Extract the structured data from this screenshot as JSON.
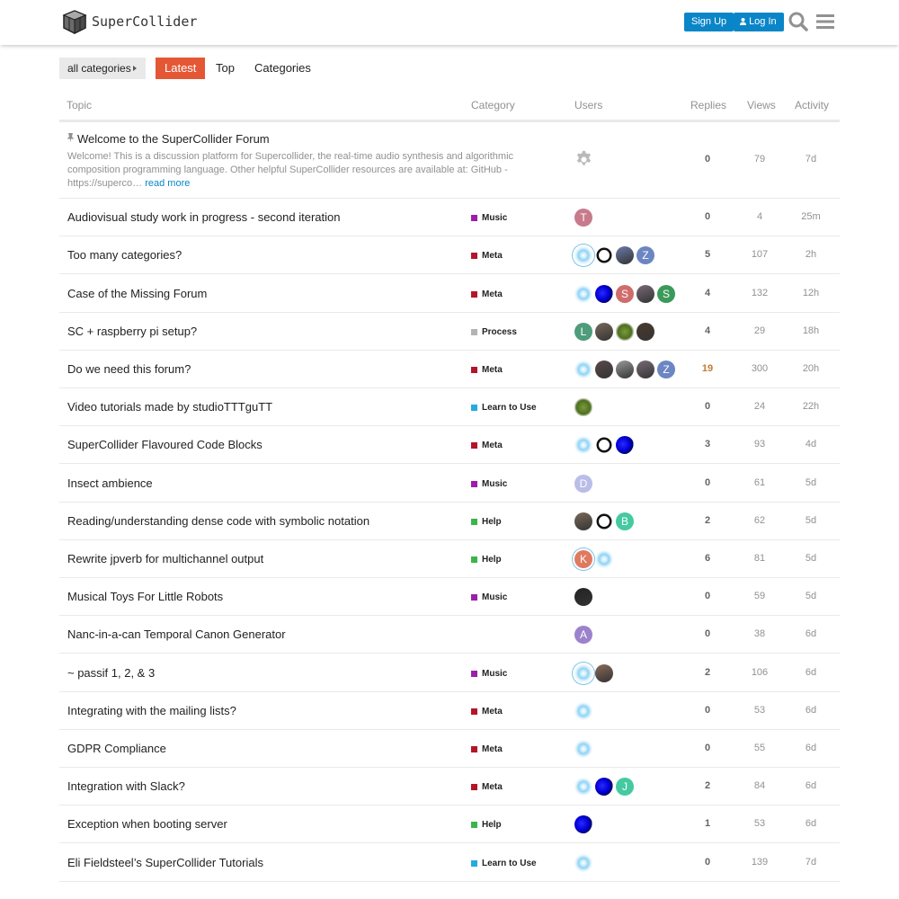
{
  "header": {
    "logo_text": "SuperCollider",
    "signup_label": "Sign Up",
    "login_label": "Log In",
    "icons": [
      "search-icon",
      "hamburger-menu-icon",
      "cube-logo-icon",
      "user-icon"
    ]
  },
  "nav": {
    "category_dropdown": "all categories",
    "tabs": [
      "Latest",
      "Top",
      "Categories"
    ],
    "active_tab": "Latest"
  },
  "columns": [
    "Topic",
    "Category",
    "Users",
    "Replies",
    "Views",
    "Activity"
  ],
  "colors": {
    "accent": "#e45735",
    "link": "#0a86c8",
    "Music": "#9b1fa8",
    "Meta": "#b3152b",
    "Process": "#b3b3b3",
    "Learn to Use": "#25aae1",
    "Help": "#3ab54a"
  },
  "pinned": {
    "title": "Welcome to the SuperCollider Forum",
    "excerpt": "Welcome! This is a discussion platform for Supercollider, the real-time audio synthesis and algorithmic composition programming language. Other helpful SuperCollider resources are available at: GitHub - https://superco…",
    "read_more": "read more",
    "replies": "0",
    "views": "79",
    "activity": "7d"
  },
  "topics": [
    {
      "title": "Audiovisual study work in progress - second iteration",
      "category": "Music",
      "replies": "0",
      "views": "4",
      "activity": "25m",
      "users": [
        {
          "letter": "T",
          "bg": "#c77b8b"
        }
      ]
    },
    {
      "title": "Too many categories?",
      "category": "Meta",
      "replies": "5",
      "views": "107",
      "activity": "2h",
      "users": [
        {
          "type": "glow",
          "ring": true
        },
        {
          "type": "loop"
        },
        {
          "type": "pic",
          "bg": "#6a7ba8"
        },
        {
          "letter": "Z",
          "bg": "#6b86c2"
        }
      ]
    },
    {
      "title": "Case of the Missing Forum",
      "category": "Meta",
      "replies": "4",
      "views": "132",
      "activity": "12h",
      "users": [
        {
          "type": "glow"
        },
        {
          "type": "blob"
        },
        {
          "letter": "S",
          "bg": "#d06c6c"
        },
        {
          "type": "pic",
          "bg": "#7a6a78"
        },
        {
          "letter": "S",
          "bg": "#3b9a5a"
        }
      ]
    },
    {
      "title": "SC + raspberry pi setup?",
      "category": "Process",
      "replies": "4",
      "views": "29",
      "activity": "18h",
      "users": [
        {
          "letter": "L",
          "bg": "#4f9c7a"
        },
        {
          "type": "pic",
          "bg": "#7a6a5a"
        },
        {
          "type": "moss"
        },
        {
          "type": "pic",
          "bg": "#4a3a2a"
        }
      ]
    },
    {
      "title": "Do we need this forum?",
      "category": "Meta",
      "replies": "19",
      "views": "300",
      "activity": "20h",
      "hot": true,
      "users": [
        {
          "type": "glow"
        },
        {
          "type": "pic",
          "bg": "#5a4a4a"
        },
        {
          "type": "pic",
          "bg": "#9a9a9a"
        },
        {
          "type": "pic",
          "bg": "#7a6a78"
        },
        {
          "letter": "Z",
          "bg": "#6b86c2"
        }
      ]
    },
    {
      "title": "Video tutorials made by studioTTTguTT",
      "category": "Learn to Use",
      "replies": "0",
      "views": "24",
      "activity": "22h",
      "users": [
        {
          "type": "moss"
        }
      ]
    },
    {
      "title": "SuperCollider Flavoured Code Blocks",
      "category": "Meta",
      "replies": "3",
      "views": "93",
      "activity": "4d",
      "users": [
        {
          "type": "glow"
        },
        {
          "type": "loop"
        },
        {
          "type": "blob"
        }
      ]
    },
    {
      "title": "Insect ambience",
      "category": "Music",
      "replies": "0",
      "views": "61",
      "activity": "5d",
      "users": [
        {
          "letter": "D",
          "bg": "#b9bde8"
        }
      ]
    },
    {
      "title": "Reading/understanding dense code with symbolic notation",
      "category": "Help",
      "replies": "2",
      "views": "62",
      "activity": "5d",
      "users": [
        {
          "type": "pic",
          "bg": "#7a6a5a"
        },
        {
          "type": "loop"
        },
        {
          "letter": "B",
          "bg": "#45c9a0"
        }
      ]
    },
    {
      "title": "Rewrite jpverb for multichannel output",
      "category": "Help",
      "replies": "6",
      "views": "81",
      "activity": "5d",
      "users": [
        {
          "letter": "K",
          "bg": "#e07a5f",
          "ring": true
        },
        {
          "type": "glow"
        }
      ]
    },
    {
      "title": "Musical Toys For Little Robots",
      "category": "Music",
      "replies": "0",
      "views": "59",
      "activity": "5d",
      "users": [
        {
          "type": "pic",
          "bg": "#222222"
        }
      ]
    },
    {
      "title": "Nanc-in-a-can Temporal Canon Generator",
      "category": "",
      "replies": "0",
      "views": "38",
      "activity": "6d",
      "users": [
        {
          "letter": "A",
          "bg": "#9c82cc"
        }
      ]
    },
    {
      "title": "~ passif 1, 2, & 3",
      "category": "Music",
      "replies": "2",
      "views": "106",
      "activity": "6d",
      "users": [
        {
          "type": "glow",
          "ring": true
        },
        {
          "type": "pic",
          "bg": "#8a6a5a"
        }
      ]
    },
    {
      "title": "Integrating with the mailing lists?",
      "category": "Meta",
      "replies": "0",
      "views": "53",
      "activity": "6d",
      "users": [
        {
          "type": "glow"
        }
      ]
    },
    {
      "title": "GDPR Compliance",
      "category": "Meta",
      "replies": "0",
      "views": "55",
      "activity": "6d",
      "users": [
        {
          "type": "glow"
        }
      ]
    },
    {
      "title": "Integration with Slack?",
      "category": "Meta",
      "replies": "2",
      "views": "84",
      "activity": "6d",
      "users": [
        {
          "type": "glow"
        },
        {
          "type": "blob"
        },
        {
          "letter": "J",
          "bg": "#45c9a0"
        }
      ]
    },
    {
      "title": "Exception when booting server",
      "category": "Help",
      "replies": "1",
      "views": "53",
      "activity": "6d",
      "users": [
        {
          "type": "blob"
        }
      ]
    },
    {
      "title": "Eli Fieldsteel’s SuperCollider Tutorials",
      "category": "Learn to Use",
      "replies": "0",
      "views": "139",
      "activity": "7d",
      "users": [
        {
          "type": "glow"
        }
      ]
    }
  ]
}
